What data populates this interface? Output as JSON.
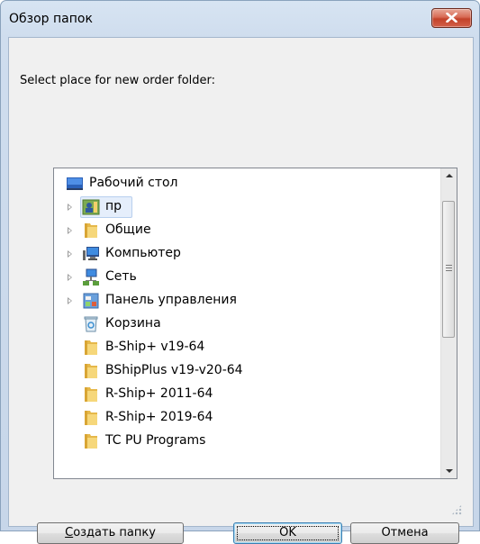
{
  "window": {
    "title": "Обзор папок",
    "prompt": "Select place for new order folder:"
  },
  "tree": {
    "items": [
      {
        "label": "Рабочий стол",
        "icon": "desktop-icon",
        "expander": false,
        "selected": false
      },
      {
        "label": "пр",
        "icon": "user-folder-icon",
        "expander": true,
        "selected": true
      },
      {
        "label": "Общие",
        "icon": "folder-icon",
        "expander": true,
        "selected": false
      },
      {
        "label": "Компьютер",
        "icon": "computer-icon",
        "expander": true,
        "selected": false
      },
      {
        "label": "Сеть",
        "icon": "network-icon",
        "expander": true,
        "selected": false
      },
      {
        "label": "Панель управления",
        "icon": "control-panel-icon",
        "expander": true,
        "selected": false
      },
      {
        "label": "Корзина",
        "icon": "recycle-bin-icon",
        "expander": false,
        "selected": false
      },
      {
        "label": "B-Ship+ v19-64",
        "icon": "folder-icon",
        "expander": false,
        "selected": false
      },
      {
        "label": "BShipPlus v19-v20-64",
        "icon": "folder-icon",
        "expander": false,
        "selected": false
      },
      {
        "label": "R-Ship+ 2011-64",
        "icon": "folder-icon",
        "expander": false,
        "selected": false
      },
      {
        "label": "R-Ship+ 2019-64",
        "icon": "folder-icon",
        "expander": false,
        "selected": false
      },
      {
        "label": "TC PU Programs",
        "icon": "folder-icon",
        "expander": false,
        "selected": false
      }
    ]
  },
  "buttons": {
    "new_folder_first": "С",
    "new_folder_rest": "оздать папку",
    "ok": "OK",
    "cancel": "Отмена"
  },
  "colors": {
    "close_button": "#c9452d",
    "selection": "#e5eefb",
    "default_button_border": "#3c7fb1"
  }
}
